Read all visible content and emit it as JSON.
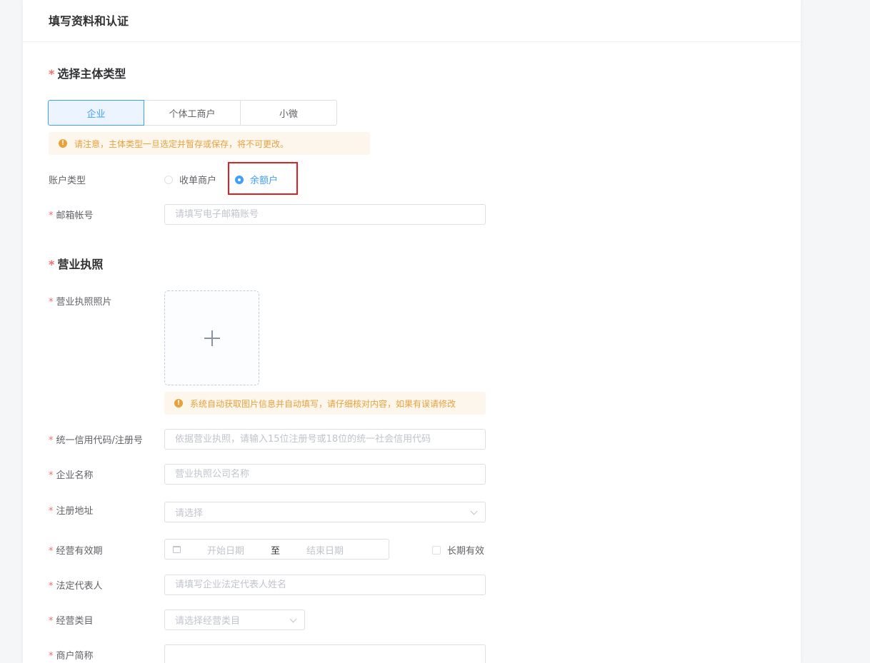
{
  "header": {
    "title": "填写资料和认证"
  },
  "subject_section": {
    "title": "选择主体类型",
    "tabs": [
      {
        "label": "企业",
        "active": true
      },
      {
        "label": "个体工商户",
        "active": false
      },
      {
        "label": "小微",
        "active": false
      }
    ],
    "warning": "请注意，主体类型一旦选定并暂存或保存，将不可更改。"
  },
  "account_type": {
    "label": "账户类型",
    "options": [
      {
        "label": "收单商户",
        "checked": false
      },
      {
        "label": "余额户",
        "checked": true
      }
    ]
  },
  "email": {
    "label": "邮箱帐号",
    "placeholder": "请填写电子邮箱账号"
  },
  "license_section": {
    "title": "营业执照",
    "photo_label": "营业执照照片",
    "photo_tip": "系统自动获取图片信息并自动填写，请仔细核对内容，如果有误请修改"
  },
  "credit_code": {
    "label": "统一信用代码/注册号",
    "placeholder": "依据营业执照，请输入15位注册号或18位的统一社会信用代码"
  },
  "company_name": {
    "label": "企业名称",
    "placeholder": "营业执照公司名称"
  },
  "address": {
    "label": "注册地址",
    "placeholder": "请选择"
  },
  "validity": {
    "label": "经营有效期",
    "start_placeholder": "开始日期",
    "separator": "至",
    "end_placeholder": "结束日期",
    "long_term_label": "长期有效"
  },
  "legal_rep": {
    "label": "法定代表人",
    "placeholder": "请填写企业法定代表人姓名"
  },
  "category": {
    "label": "经营类目",
    "placeholder": "请选择经营类目"
  },
  "short_name": {
    "label": "商户简称",
    "placeholder": ""
  },
  "required_mark": "*",
  "warning_icon_glyph": "!",
  "colors": {
    "primary": "#409eff",
    "warning": "#e6a23c",
    "required": "#f56c6c",
    "highlight": "#e02020"
  }
}
